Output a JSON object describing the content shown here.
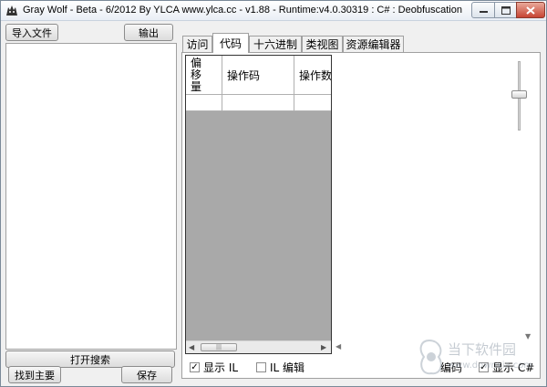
{
  "window": {
    "title": "Gray Wolf - Beta - 6/2012  By YLCA  www.ylca.cc - v1.88 - Runtime:v4.0.30319 : C# : Deobfuscation",
    "min_icon": "minimize-icon",
    "max_icon": "maximize-icon",
    "close_icon": "close-icon"
  },
  "left": {
    "import_label": "导入文件",
    "output_label": "输出",
    "search_label": "打开搜索",
    "find_main_label": "找到主要",
    "save_label": "保存"
  },
  "tabs": [
    {
      "label": "访问"
    },
    {
      "label": "代码",
      "active": true
    },
    {
      "label": "十六进制"
    },
    {
      "label": "类视图"
    },
    {
      "label": "资源编辑器"
    }
  ],
  "grid": {
    "headers": [
      "偏\n移\n量",
      "操作码",
      "操作数"
    ]
  },
  "options": {
    "show_il": {
      "label": "显示 IL",
      "checked": true
    },
    "il_edit": {
      "label": "IL 编辑",
      "checked": false
    },
    "encode_label": "编码",
    "show_csharp": {
      "label": "显示 C#",
      "checked": true
    }
  },
  "watermark": {
    "text": "当下软件园",
    "url": "www.downxia.com"
  },
  "colors": {
    "grid_background": "#a9a9a9",
    "close_button": "#c74433"
  }
}
